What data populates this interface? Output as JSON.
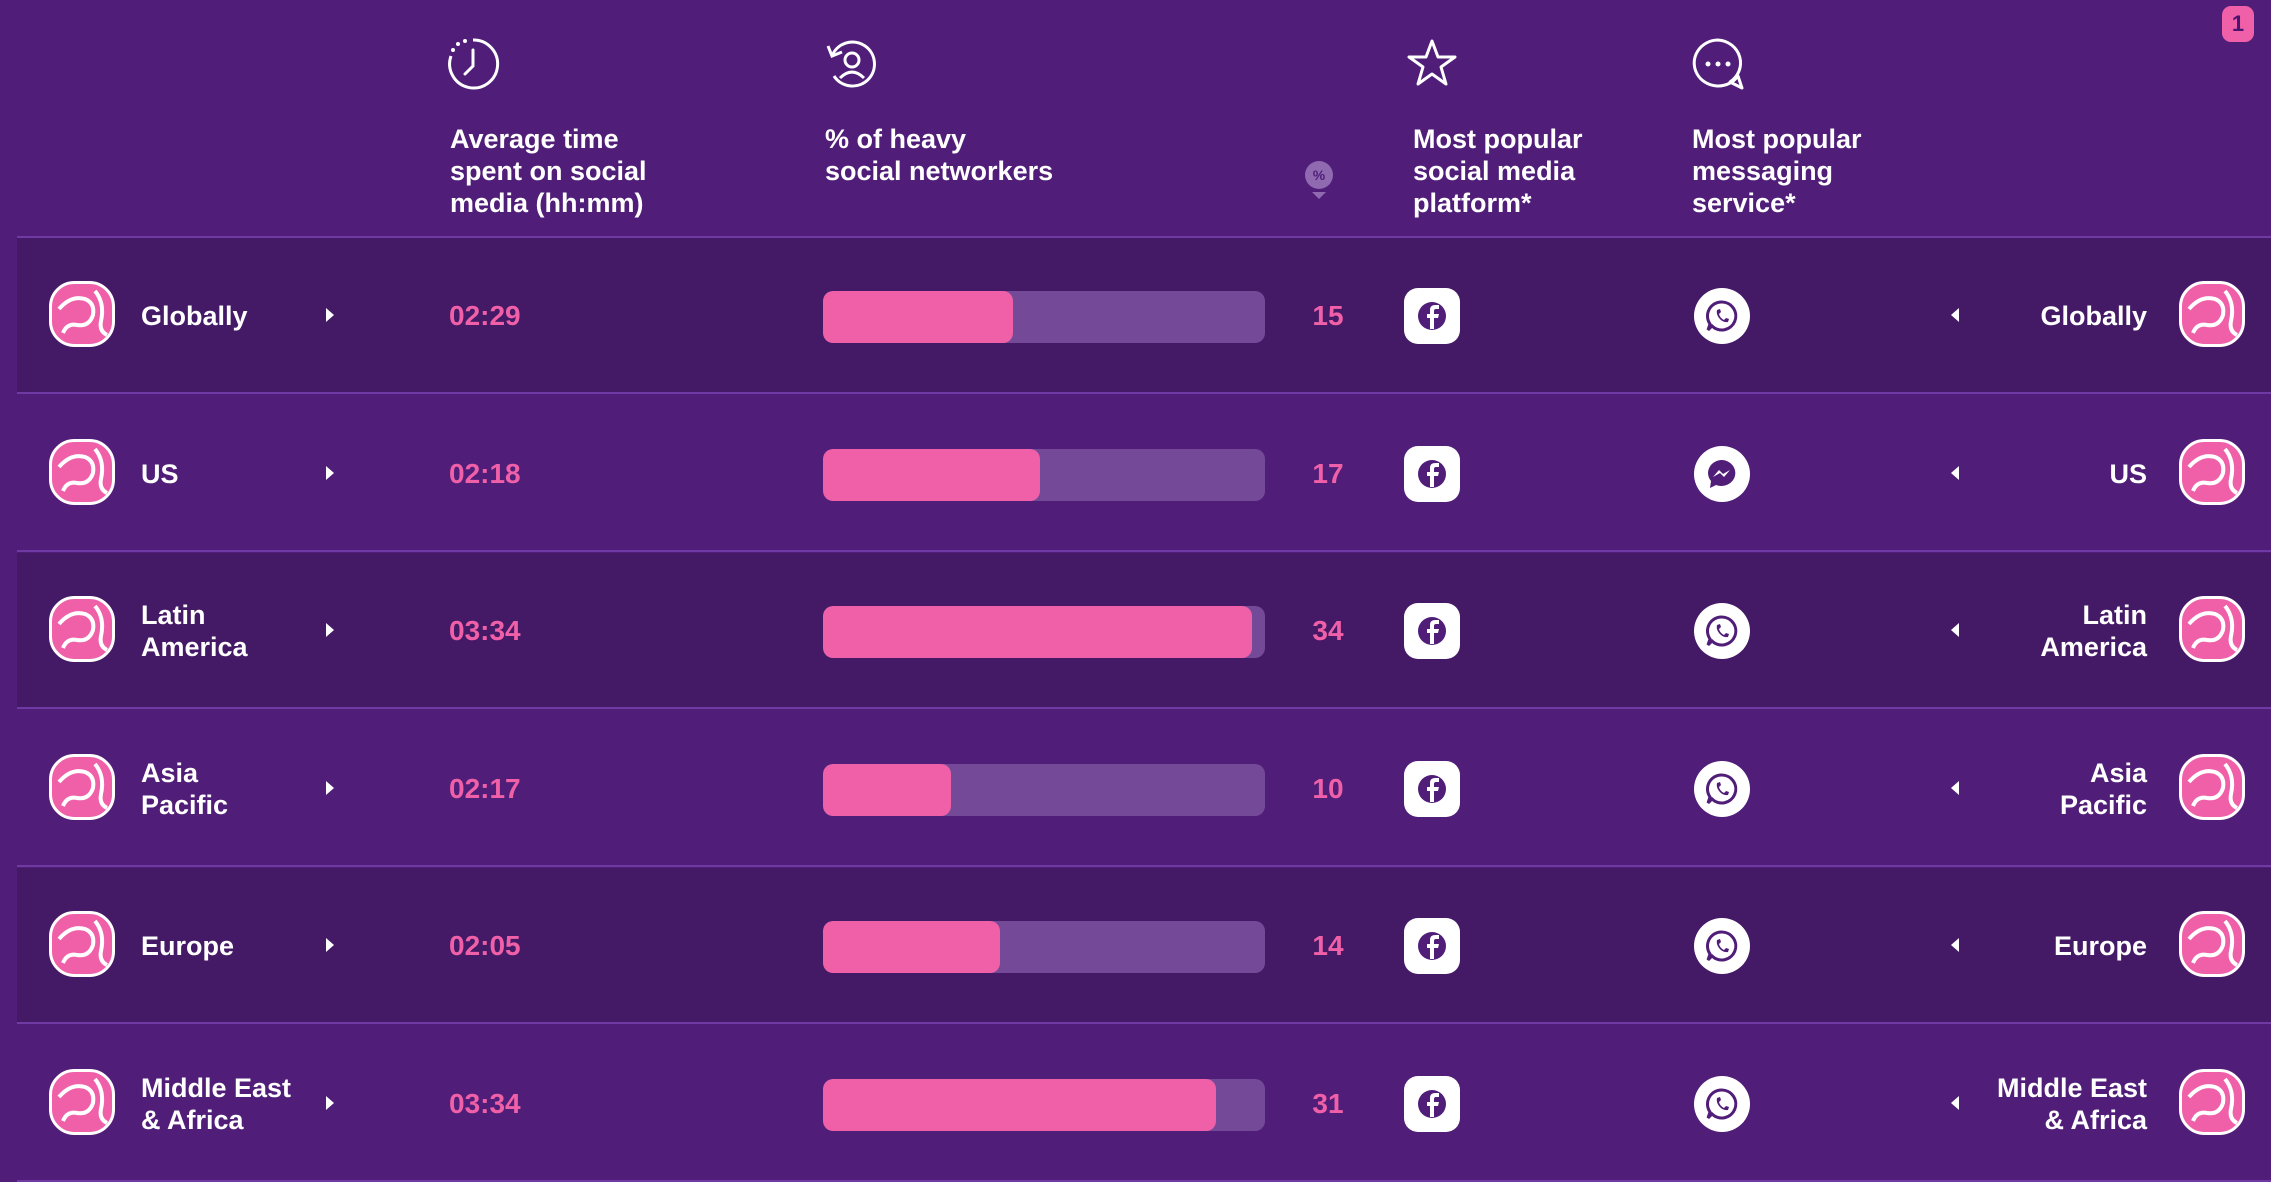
{
  "badge": "1",
  "headers": {
    "time": "Average time\nspent on social\nmedia (hh:mm)",
    "heavy": "% of heavy\nsocial networkers",
    "pct_symbol": "%",
    "platform": "Most popular\nsocial media\nplatform*",
    "messaging": "Most popular\nmessaging\nservice*"
  },
  "header_icons": [
    "clock-icon",
    "user-refresh-icon",
    "percent-pin-icon",
    "star-icon",
    "chat-bubble-icon"
  ],
  "colors": {
    "background": "#501e78",
    "row_alt": "#441966",
    "accent": "#f060a8",
    "track": "#744a98"
  },
  "rows": [
    {
      "region": "Globally",
      "time": "02:29",
      "pct": 15,
      "pct_label": "15",
      "bar_fraction": 0.43,
      "platform": "facebook",
      "messaging": "whatsapp",
      "globe": "globe-icon"
    },
    {
      "region": "US",
      "time": "02:18",
      "pct": 17,
      "pct_label": "17",
      "bar_fraction": 0.49,
      "platform": "facebook",
      "messaging": "messenger",
      "globe": "us-map-icon"
    },
    {
      "region": "Latin\nAmerica",
      "time": "03:34",
      "pct": 34,
      "pct_label": "34",
      "bar_fraction": 0.97,
      "platform": "facebook",
      "messaging": "whatsapp",
      "globe": "south-america-icon"
    },
    {
      "region": "Asia\nPacific",
      "time": "02:17",
      "pct": 10,
      "pct_label": "10",
      "bar_fraction": 0.29,
      "platform": "facebook",
      "messaging": "whatsapp",
      "globe": "asia-pacific-icon"
    },
    {
      "region": "Europe",
      "time": "02:05",
      "pct": 14,
      "pct_label": "14",
      "bar_fraction": 0.4,
      "platform": "facebook",
      "messaging": "whatsapp",
      "globe": "europe-icon"
    },
    {
      "region": "Middle East\n& Africa",
      "time": "03:34",
      "pct": 31,
      "pct_label": "31",
      "bar_fraction": 0.89,
      "platform": "facebook",
      "messaging": "whatsapp",
      "globe": "africa-icon"
    }
  ]
}
